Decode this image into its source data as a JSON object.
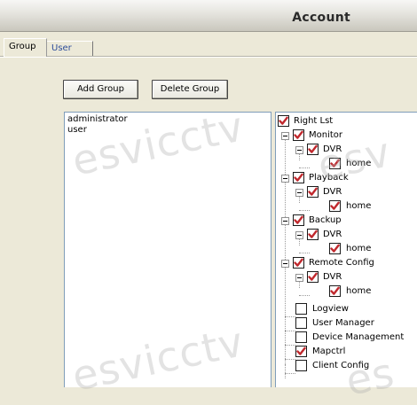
{
  "window": {
    "title": "Account"
  },
  "tabs": [
    {
      "label": "Group",
      "active": true
    },
    {
      "label": "User",
      "active": false
    }
  ],
  "toolbar": {
    "add_group_label": "Add Group",
    "delete_group_label": "Delete Group"
  },
  "groups": [
    "administrator",
    "user"
  ],
  "tree": {
    "root": "Right Lst",
    "monitor": "Monitor",
    "monitor_dvr": "DVR",
    "monitor_home": "home",
    "playback": "Playback",
    "playback_dvr": "DVR",
    "playback_home": "home",
    "backup": "Backup",
    "backup_dvr": "DVR",
    "backup_home": "home",
    "remote": "Remote Config",
    "remote_dvr": "DVR",
    "remote_home": "home",
    "logview": "Logview",
    "usermgr": "User Manager",
    "devmgmt": "Device Management",
    "mapctrl": "Mapctrl",
    "client": "Client Config"
  },
  "checked": {
    "root": true,
    "monitor": true,
    "monitor_dvr": true,
    "monitor_home": true,
    "playback": true,
    "playback_dvr": true,
    "playback_home": true,
    "backup": true,
    "backup_dvr": true,
    "backup_home": true,
    "remote": true,
    "remote_dvr": true,
    "remote_home": true,
    "logview": false,
    "usermgr": false,
    "devmgmt": false,
    "mapctrl": true,
    "client": false
  },
  "watermark": "esvicctv",
  "colors": {
    "check": "#c0282d",
    "tab_label": "#2d4d9a",
    "list_border": "#7f9db9"
  }
}
